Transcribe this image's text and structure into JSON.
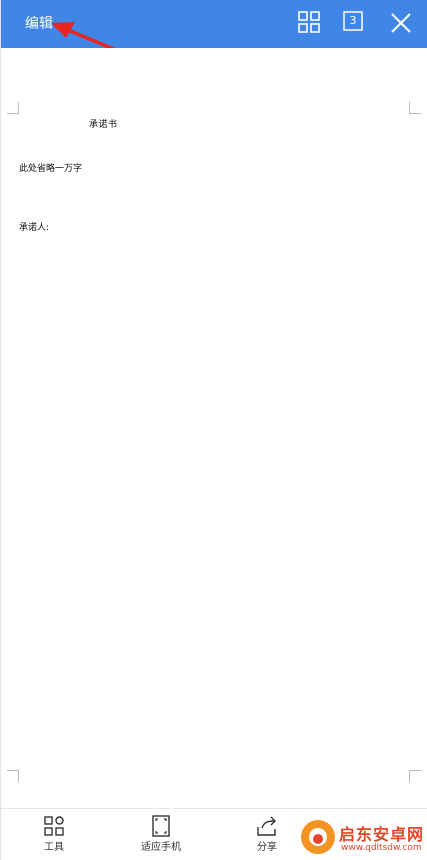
{
  "toolbar": {
    "edit_label": "编辑",
    "page_count": "3"
  },
  "document": {
    "title": "承诺书",
    "body": "此处省略一万字",
    "signature": "承诺人:"
  },
  "bottom_bar": {
    "tools_label": "工具",
    "fit_label": "适应手机",
    "share_label": "分享"
  },
  "watermark": {
    "title": "启东安卓网",
    "url": "www.qdltsdw.com"
  },
  "colors": {
    "topbar": "#3f86e6",
    "annotation": "#e8261e"
  }
}
